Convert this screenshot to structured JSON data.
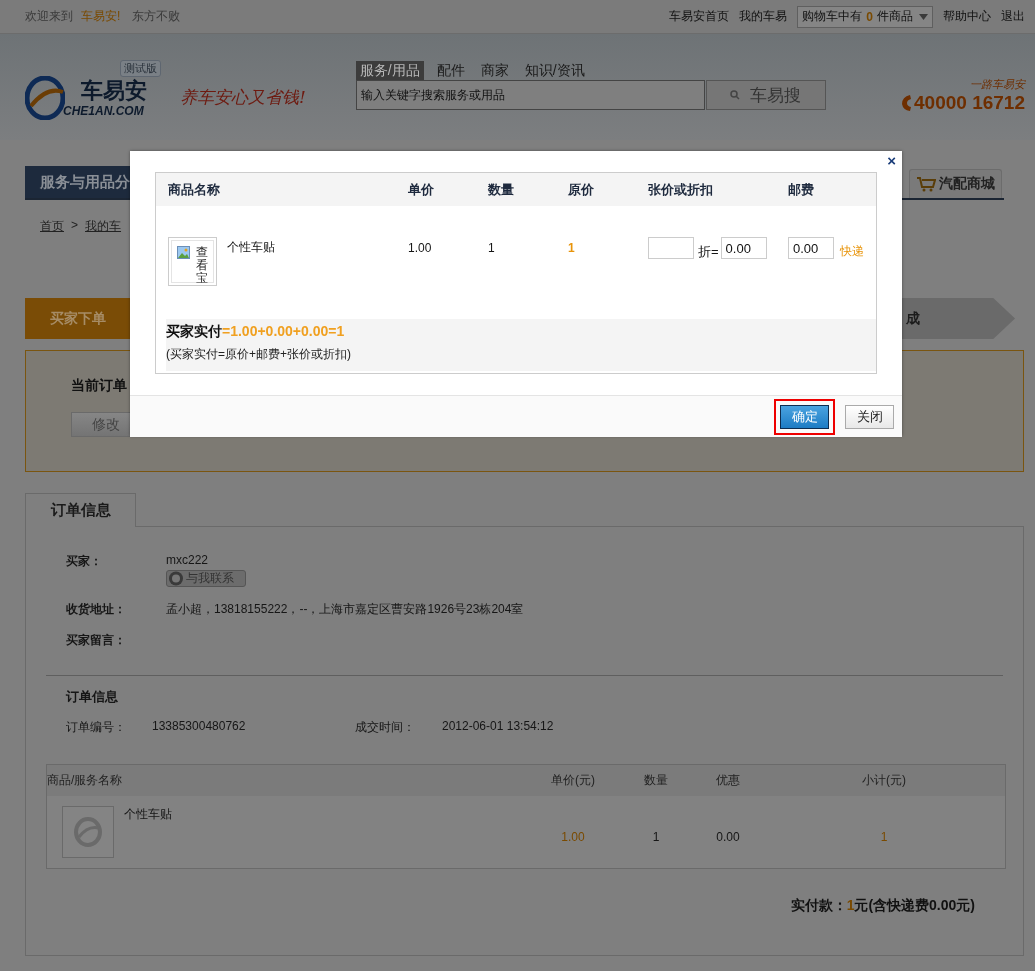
{
  "top_bar": {
    "welcome": "欢迎来到",
    "brand": "车易安!",
    "slogan": "东方不败",
    "links": [
      "车易安首页",
      "我的车易"
    ],
    "cart": {
      "prefix": "购物车中有",
      "count": "0",
      "suffix": "件商品"
    },
    "links_right": [
      "帮助中心",
      "退出"
    ]
  },
  "header": {
    "logo_badge": "测试版",
    "logo_text": "车易安",
    "logo_sub": "CHE1AN.COM",
    "tagline": "养车安心又省钱!",
    "search_tabs": [
      {
        "label": "服务/用品",
        "selected": true
      },
      {
        "label": "配件",
        "selected": false
      },
      {
        "label": "商家",
        "selected": false
      },
      {
        "label": "知识/资讯",
        "selected": false
      }
    ],
    "search": {
      "placeholder": "输入关键字搜索服务或用品"
    },
    "search_button": "车易搜",
    "hotline_label": "一路车易安",
    "hotline": "40000 16712"
  },
  "nav": {
    "category_menu": "服务与用品分",
    "tab": "汽配商城"
  },
  "breadcrumb": {
    "items": [
      "首页",
      "我的车"
    ],
    "separator": ">"
  },
  "steps": [
    {
      "label": "买家下单",
      "selected": true
    },
    {
      "label": "成",
      "selected": false
    }
  ],
  "current_order": {
    "title": "当前订单",
    "button": "修改"
  },
  "order_panel": {
    "tab": "订单信息",
    "buyer": {
      "label": "买家：",
      "value": "mxc222",
      "contact_button": "与我联系"
    },
    "address": {
      "label": "收货地址：",
      "value": "孟小超，13818155222，--，上海市嘉定区曹安路1926号23栋204室"
    },
    "message": {
      "label": "买家留言："
    },
    "section_title": "订单信息",
    "order_no": {
      "label": "订单编号：",
      "value": "13385300480762"
    },
    "deal_time": {
      "label": "成交时间：",
      "value": "2012-06-01 13:54:12"
    },
    "items_table": {
      "columns": [
        "商品/服务名称",
        "单价(元)",
        "数量",
        "优惠",
        "小计(元)"
      ],
      "rows": [
        {
          "name": "个性车贴",
          "price": "1.00",
          "qty": "1",
          "discount": "0.00",
          "subtotal": "1"
        }
      ]
    },
    "total": {
      "label": "实付款：",
      "amount": "1",
      "note": "元(含快递费0.00元)"
    }
  },
  "dialog": {
    "close": "×",
    "columns": [
      "商品名称",
      "单价",
      "数量",
      "原价",
      "张价或折扣",
      "邮费"
    ],
    "item": {
      "image_alt": "查看宝",
      "name": "个性车贴",
      "price": "1.00",
      "qty": "1",
      "original_price": "1",
      "discount_label": "折=",
      "discount_value": "0.00",
      "shipping_value": "0.00",
      "shipping_method": "快递"
    },
    "formula": {
      "label": "买家实付",
      "expression": "=1.00+0.00+0.00=",
      "result": "1"
    },
    "formula_note": "(买家实付=原价+邮费+张价或折扣)",
    "buttons": [
      {
        "label": "确定",
        "kind": "primary",
        "highlighted": true
      },
      {
        "label": "关闭",
        "kind": "secondary",
        "highlighted": false
      }
    ]
  }
}
